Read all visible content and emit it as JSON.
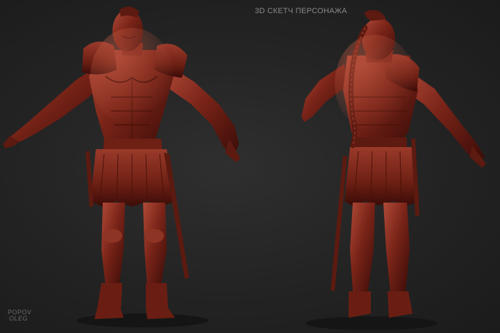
{
  "caption": "3D  СКЕТЧ ПЕРСОНАЖА",
  "signature": {
    "line1": "POPOV",
    "line2": "OLEG"
  },
  "colors": {
    "background": "#242424",
    "clay": "#7a2418",
    "clay_highlight": "#b04a38",
    "clay_shadow": "#3a0c08",
    "text": "#8a8a8a"
  },
  "views": [
    {
      "name": "front-view"
    },
    {
      "name": "back-view"
    }
  ]
}
